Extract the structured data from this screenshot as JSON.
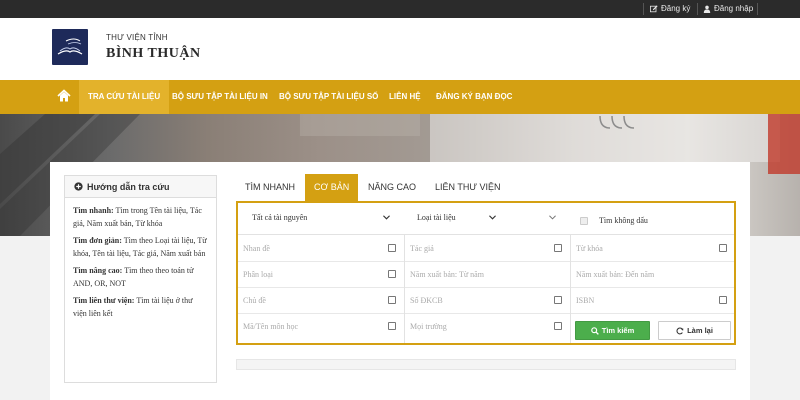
{
  "topbar": {
    "register": "Đăng ký",
    "login": "Đăng nhập"
  },
  "header": {
    "subtitle": "THƯ VIỆN TỈNH",
    "title": "BÌNH THUẬN"
  },
  "nav": {
    "items": [
      {
        "label": "TRA CỨU TÀI LIỆU",
        "active": true
      },
      {
        "label": "BỘ SƯU TẬP TÀI LIỆU IN"
      },
      {
        "label": "BỘ SƯU TẬP TÀI LIỆU SỐ"
      },
      {
        "label": "LIÊN HỆ"
      },
      {
        "label": "ĐĂNG KÝ BẠN ĐỌC"
      }
    ]
  },
  "guide": {
    "title": "Hướng dẫn tra cứu",
    "entries": [
      {
        "term": "Tìm nhanh:",
        "desc": " Tìm trong Tên tài liệu, Tác giả, Năm xuất bản, Từ khóa"
      },
      {
        "term": "Tìm đơn giản:",
        "desc": " Tìm theo Loại tài liệu, Từ khóa, Tên tài liệu, Tác giả, Năm xuất bản"
      },
      {
        "term": "Tìm nâng cao:",
        "desc": " Tìm theo theo toán tử AND, OR, NOT"
      },
      {
        "term": "Tìm liên thư viện:",
        "desc": " Tìm tài liệu ở thư viện liên kết"
      }
    ]
  },
  "tabs": [
    {
      "label": "TÌM NHANH"
    },
    {
      "label": "CƠ BẢN",
      "active": true
    },
    {
      "label": "NÂNG CAO"
    },
    {
      "label": "LIÊN THƯ VIỆN"
    }
  ],
  "form": {
    "resource_select": "Tất cả tài nguyên",
    "type_select": "Loại tài liệu",
    "no_accent_label": "Tìm không dấu",
    "fields": {
      "nhan_de": "Nhan đề",
      "tac_gia": "Tác giả",
      "tu_khoa": "Từ khóa",
      "phan_loai": "Phân loại",
      "nam_tu": "Năm xuất bản: Từ năm",
      "nam_den": "Năm xuất bản: Đến năm",
      "chu_de": "Chủ đề",
      "so_dkcb": "Số ĐKCB",
      "isbn": "ISBN",
      "ma_mon_hoc": "Mã/Tên môn học",
      "moi_truong": "Mọi trường"
    },
    "search_button": "Tìm kiếm",
    "reset_button": "Làm lại"
  },
  "colors": {
    "accent": "#d4a012",
    "topbar": "#2b2b2b",
    "logo": "#1e2a5a",
    "search_button": "#4cae4c"
  }
}
